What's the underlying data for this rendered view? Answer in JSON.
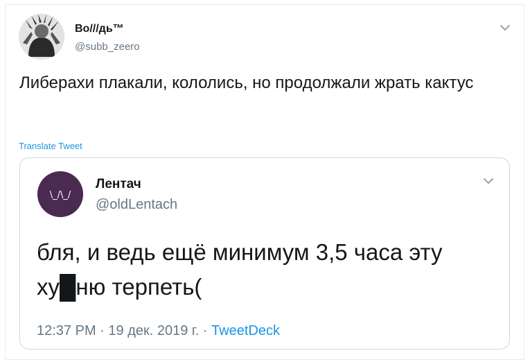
{
  "tweet": {
    "display_name": "Во///дь™",
    "handle": "@subb_zeero",
    "text": "Либерахи плакали, кололись, но продолжали жрать кактус",
    "translate_label": "Translate Tweet",
    "menu_icon": "chevron-down-icon"
  },
  "quoted_tweet": {
    "display_name": "Лентач",
    "handle": "@oldLentach",
    "text": "бля, и ведь ещё минимум 3,5 часа эту ху█ню терпеть(",
    "time": "12:37 PM",
    "separator": "·",
    "date": "19 дек. 2019 г.",
    "source": "TweetDeck",
    "logo_glyph": "\\_/\\_/"
  },
  "colors": {
    "link": "#1b95e0",
    "secondary_text": "#657786",
    "border": "#ccd6dd",
    "lentach_avatar": "#4b2a52"
  }
}
